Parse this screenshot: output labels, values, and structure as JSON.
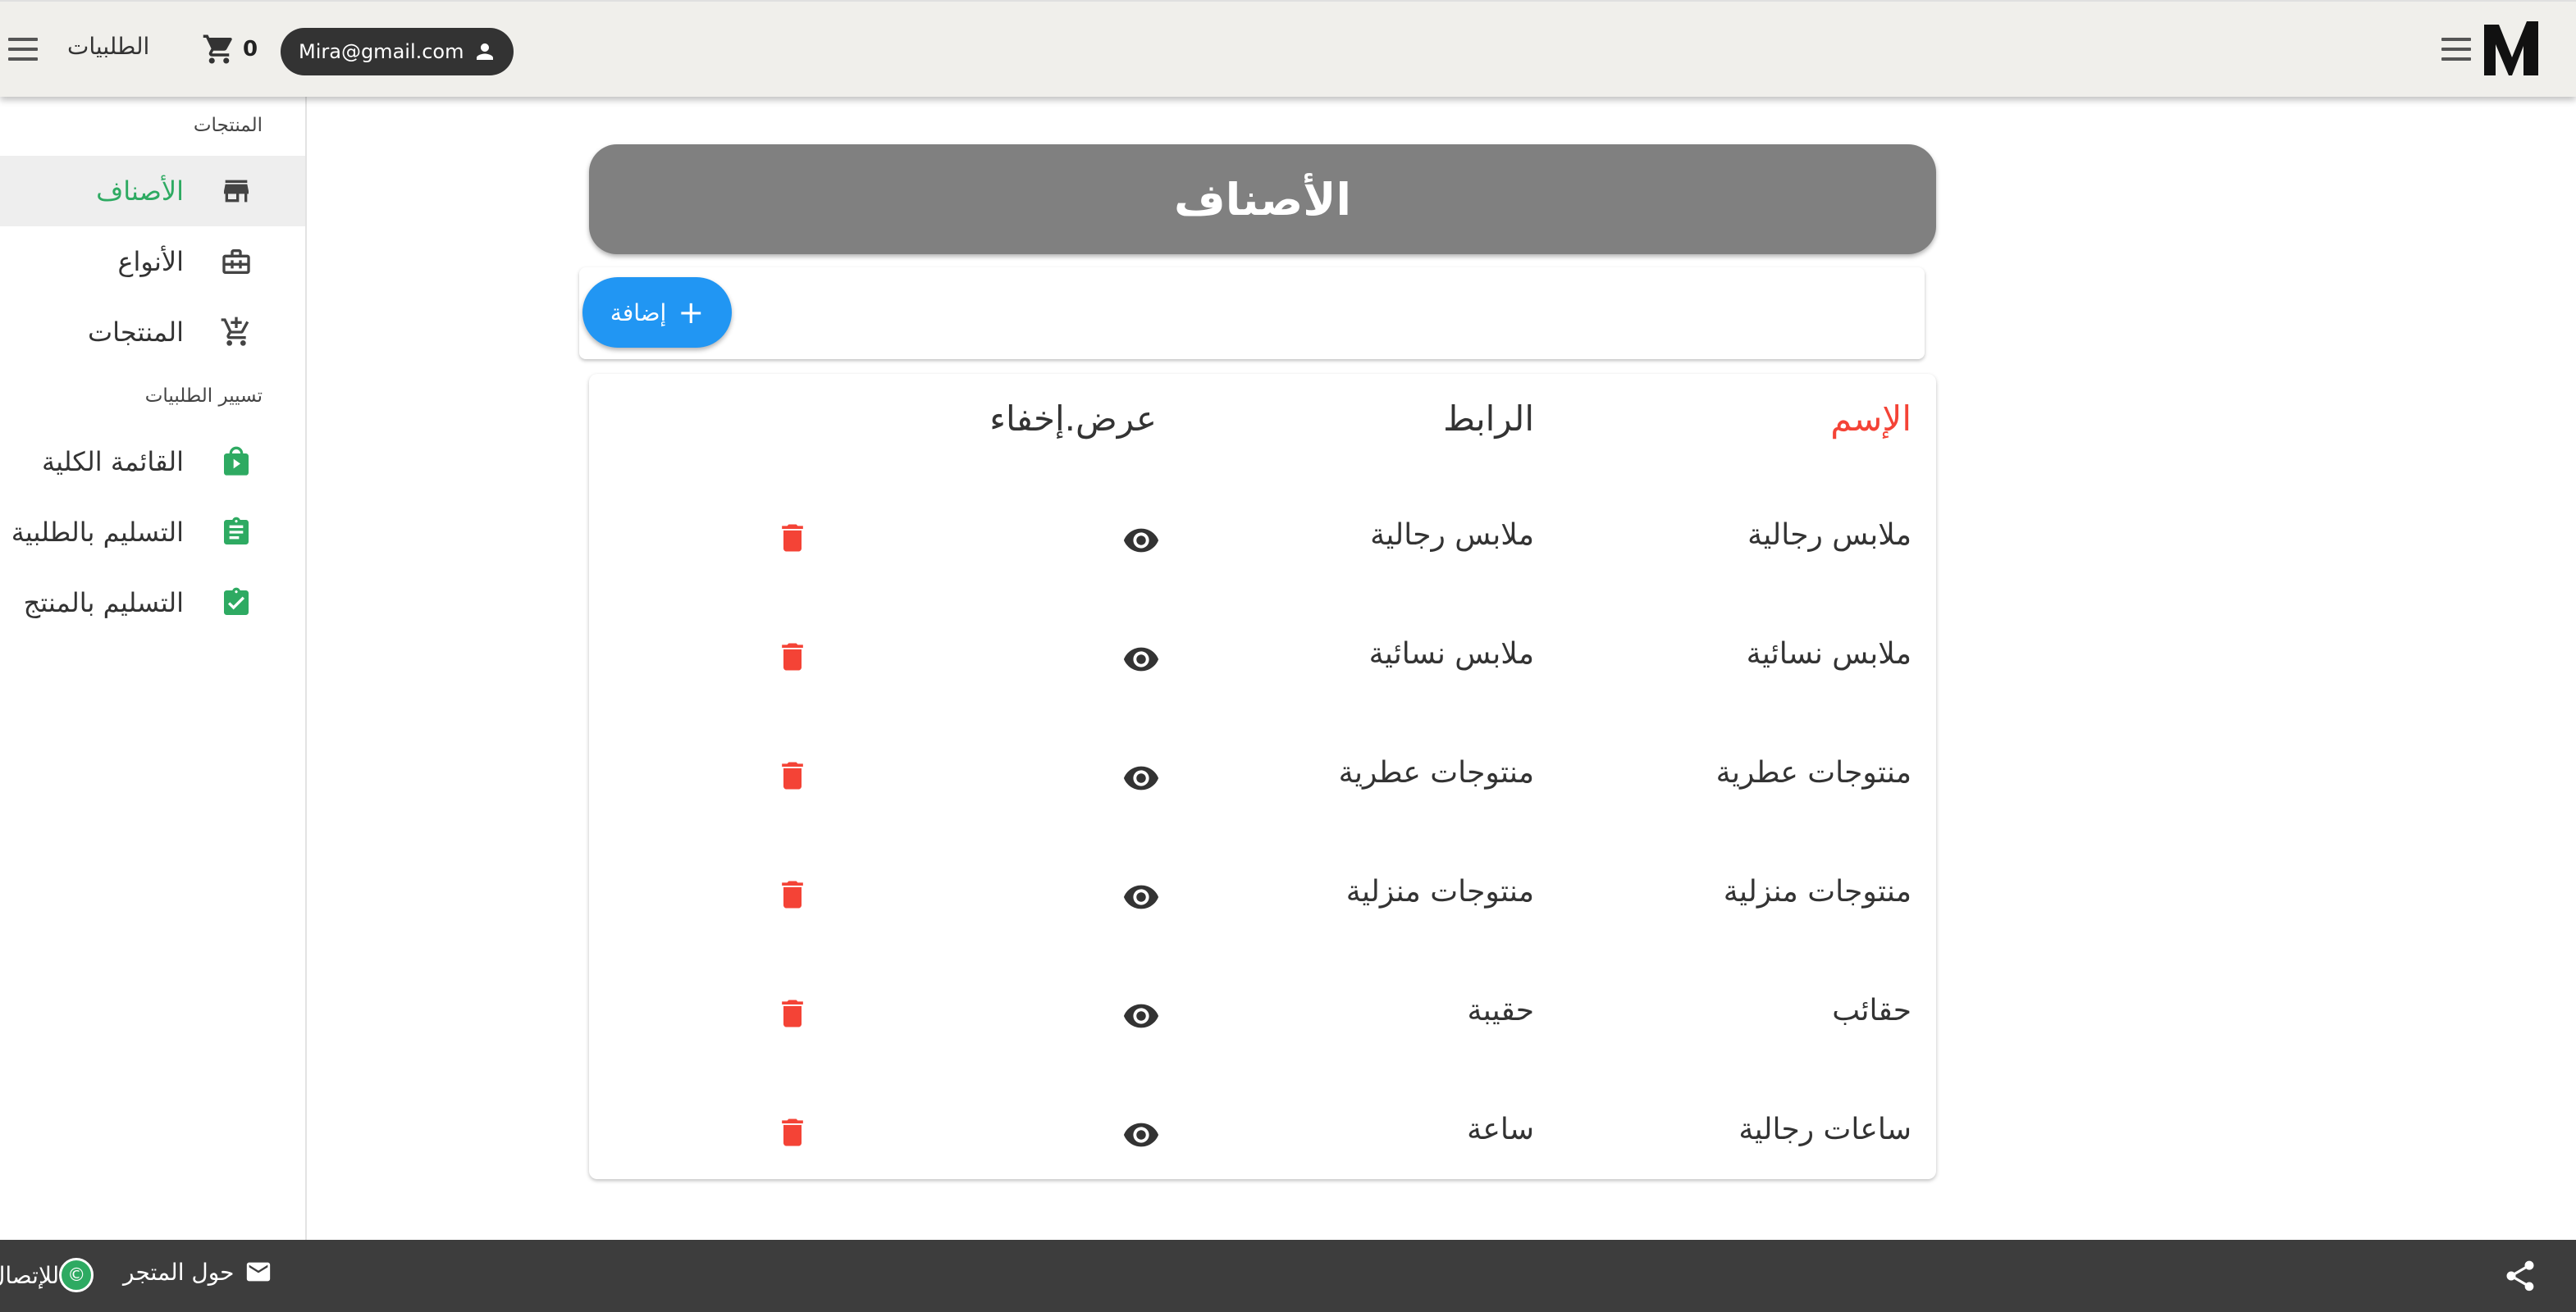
{
  "topbar": {
    "orders_label": "الطلبيات",
    "cart_count": "0",
    "user_email": "Mira@gmail.com"
  },
  "sidebar": {
    "section_products": "المنتجات",
    "section_orders": "تسيير الطلبيات",
    "items": [
      {
        "label": "الأصناف",
        "icon": "store-icon",
        "active": true
      },
      {
        "label": "الأنواع",
        "icon": "briefcase-icon"
      },
      {
        "label": "المنتجات",
        "icon": "cart-plus-icon"
      },
      {
        "label": "القائمة الكلية",
        "icon": "shopping-bag-icon"
      },
      {
        "label": "التسليم بالطلبية",
        "icon": "clipboard-list-icon"
      },
      {
        "label": "التسليم بالمنتج",
        "icon": "clipboard-check-icon"
      }
    ]
  },
  "main": {
    "title": "الأصناف",
    "add_label": "إضافة",
    "columns": {
      "name": "الإسم",
      "link": "الرابط",
      "visibility": "عرض.إخفاء"
    },
    "rows": [
      {
        "name": "ملابس رجالية",
        "link": "ملابس رجالية"
      },
      {
        "name": "ملابس نسائية",
        "link": "ملابس نسائية"
      },
      {
        "name": "منتوجات عطرية",
        "link": "منتوجات عطرية"
      },
      {
        "name": "منتوجات منزلية",
        "link": "منتوجات منزلية"
      },
      {
        "name": "حقائب",
        "link": "حقيبة"
      },
      {
        "name": "ساعات رجالية",
        "link": "ساعة"
      }
    ]
  },
  "footer": {
    "about": "حول المتجر",
    "contact": "للإتصال"
  },
  "colors": {
    "accent_green": "#2eaa62",
    "add_blue": "#2196f3",
    "delete_red": "#f44336",
    "header_gray": "#808080"
  }
}
